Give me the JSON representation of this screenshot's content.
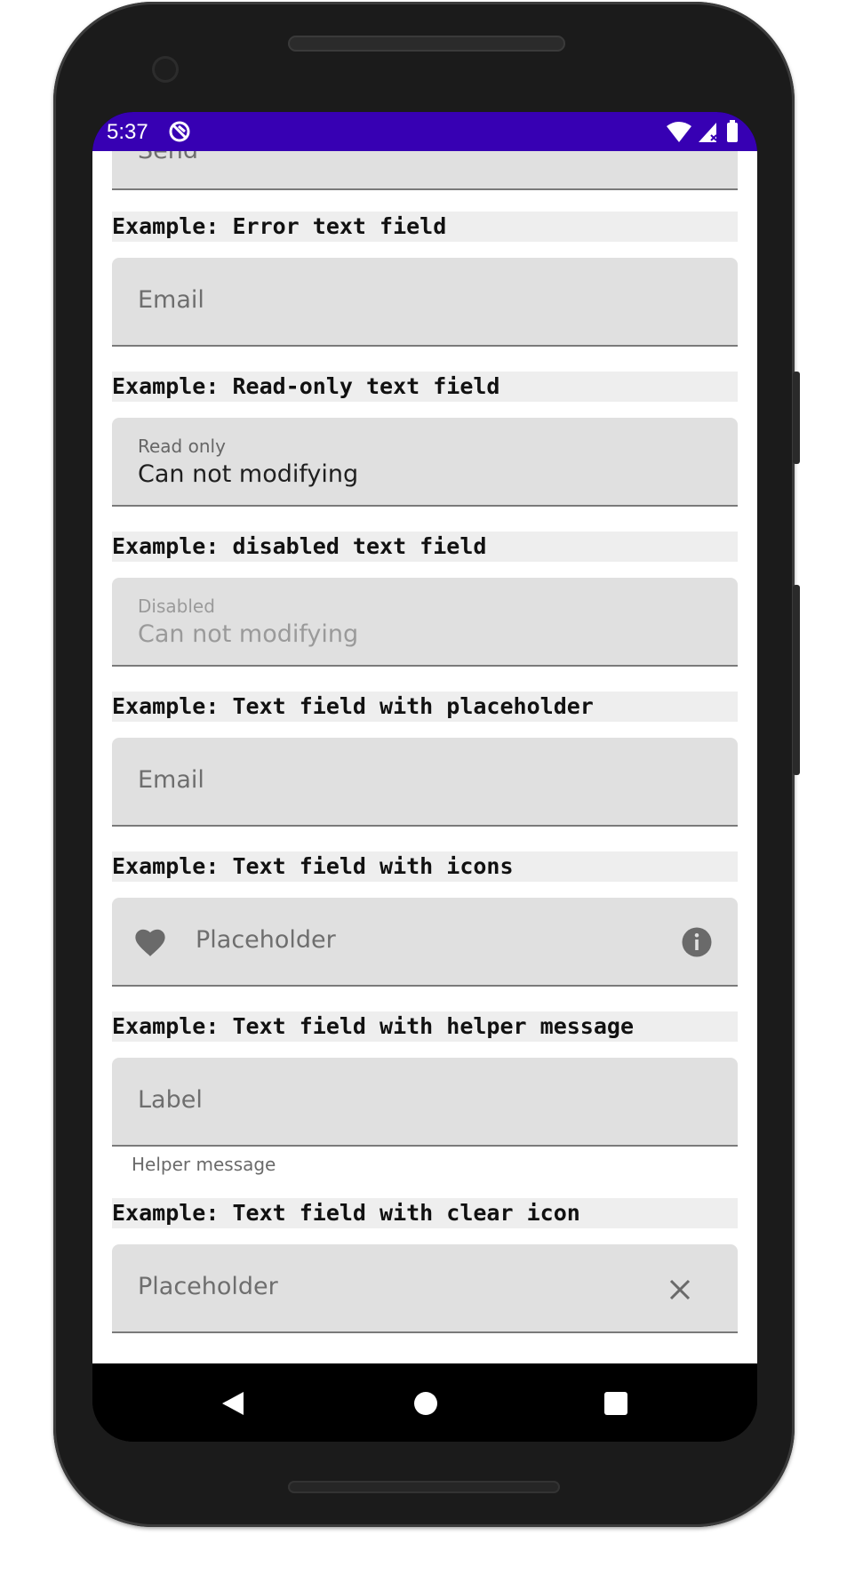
{
  "status_bar": {
    "time": "5:37",
    "color": "#3700b3",
    "icons": [
      "sync-icon",
      "wifi-icon",
      "signal-icon",
      "battery-icon"
    ]
  },
  "top_field": {
    "value": "Send"
  },
  "examples": {
    "error": {
      "title": "Example: Error text field",
      "label": "Email"
    },
    "readonly": {
      "title": "Example: Read-only text field",
      "label": "Read only",
      "value": "Can not modifying"
    },
    "disabled": {
      "title": "Example: disabled text field",
      "label": "Disabled",
      "value": "Can not modifying"
    },
    "placeholder": {
      "title": "Example: Text field with placeholder",
      "placeholder": "Email"
    },
    "icons": {
      "title": "Example: Text field with icons",
      "placeholder": "Placeholder",
      "leading_icon": "heart-icon",
      "trailing_icon": "info-icon"
    },
    "helper": {
      "title": "Example: Text field with helper message",
      "label": "Label",
      "helper": "Helper message"
    },
    "clear": {
      "title": "Example: Text field with clear icon",
      "placeholder": "Placeholder",
      "trailing_icon": "close-icon"
    }
  },
  "nav_bar": {
    "items": [
      "back",
      "home",
      "recents"
    ]
  }
}
